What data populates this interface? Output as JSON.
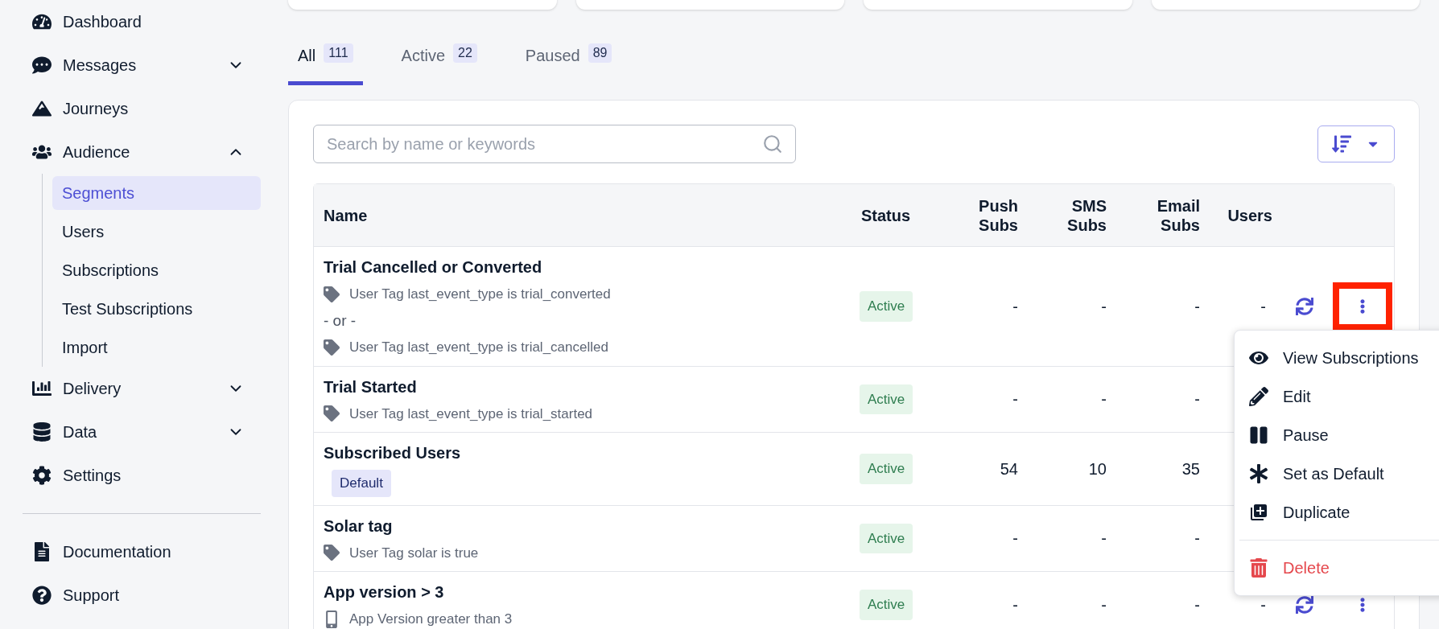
{
  "sidebar": {
    "items": [
      {
        "label": "Dashboard"
      },
      {
        "label": "Messages",
        "expanded": false
      },
      {
        "label": "Journeys"
      },
      {
        "label": "Audience",
        "expanded": true,
        "children": [
          {
            "label": "Segments",
            "selected": true
          },
          {
            "label": "Users",
            "selected": false
          },
          {
            "label": "Subscriptions",
            "selected": false
          },
          {
            "label": "Test Subscriptions",
            "selected": false
          },
          {
            "label": "Import",
            "selected": false
          }
        ]
      },
      {
        "label": "Delivery",
        "expanded": false
      },
      {
        "label": "Data",
        "expanded": false
      },
      {
        "label": "Settings"
      }
    ],
    "footer_items": [
      {
        "label": "Documentation"
      },
      {
        "label": "Support"
      }
    ]
  },
  "tabs": [
    {
      "label": "All",
      "count": "111",
      "selected": true
    },
    {
      "label": "Active",
      "count": "22",
      "selected": false
    },
    {
      "label": "Paused",
      "count": "89",
      "selected": false
    }
  ],
  "search": {
    "placeholder": "Search by name or keywords"
  },
  "table": {
    "columns": [
      "Name",
      "Status",
      "Push Subs",
      "SMS Subs",
      "Email Subs",
      "Users"
    ],
    "rows": [
      {
        "name": "Trial Cancelled or Converted",
        "conditions": [
          {
            "kind": "tag",
            "text": "User Tag last_event_type is trial_converted"
          },
          {
            "kind": "or",
            "text": "- or -"
          },
          {
            "kind": "tag",
            "text": "User Tag last_event_type is trial_cancelled"
          }
        ],
        "status": "Active",
        "push": "-",
        "sms": "-",
        "email": "-",
        "users": "-",
        "highlighted": true
      },
      {
        "name": "Trial Started",
        "conditions": [
          {
            "kind": "tag",
            "text": "User Tag last_event_type is trial_started"
          }
        ],
        "status": "Active",
        "push": "-",
        "sms": "-",
        "email": "-"
      },
      {
        "name": "Subscribed Users",
        "badge": "Default",
        "status": "Active",
        "push": "54",
        "sms": "10",
        "email": "35"
      },
      {
        "name": "Solar tag",
        "conditions": [
          {
            "kind": "tag",
            "text": "User Tag solar is true"
          }
        ],
        "status": "Active",
        "push": "-",
        "sms": "-",
        "email": "-"
      },
      {
        "name": "App version > 3",
        "conditions": [
          {
            "kind": "app",
            "text": "App Version greater than 3"
          }
        ],
        "status": "Active",
        "push": "-",
        "sms": "-",
        "email": "-",
        "users": "-",
        "highlighted": false
      }
    ]
  },
  "menu": {
    "items": [
      {
        "label": "View Subscriptions",
        "kind": "view"
      },
      {
        "label": "Edit",
        "kind": "edit"
      },
      {
        "label": "Pause",
        "kind": "pause"
      },
      {
        "label": "Set as Default",
        "kind": "default"
      },
      {
        "label": "Duplicate",
        "kind": "duplicate"
      },
      {
        "label": "Delete",
        "kind": "delete"
      }
    ]
  }
}
